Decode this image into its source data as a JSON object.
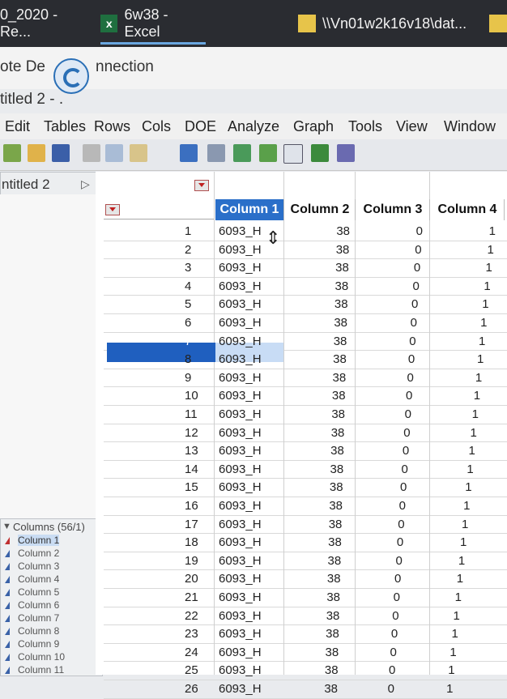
{
  "taskbar": {
    "items": [
      {
        "label": "0_2020 - Re...",
        "icon": "app-icon"
      },
      {
        "label": "6w38 - Excel",
        "icon": "excel-icon"
      },
      {
        "label": "\\\\Vn01w2k16v18\\dat...",
        "icon": "folder-icon"
      }
    ]
  },
  "remote": {
    "left_text": "ote De",
    "right_text": "nnection",
    "icon": "remote-desktop-icon"
  },
  "window_title": "titled 2 - .",
  "menu": [
    "Edit",
    "Tables",
    "Rows",
    "Cols",
    "DOE",
    "Analyze",
    "Graph",
    "Tools",
    "View",
    "Window"
  ],
  "table_panel": {
    "title": "ntitled 2"
  },
  "columns_panel": {
    "header": "Columns (56/1)",
    "items": [
      "Column 1",
      "Column 2",
      "Column 3",
      "Column 4",
      "Column 5",
      "Column 6",
      "Column 7",
      "Column 8",
      "Column 9",
      "Column 10",
      "Column 11"
    ]
  },
  "grid": {
    "headers": [
      "Column 1",
      "Column 2",
      "Column 3",
      "Column 4"
    ],
    "selected_row": 7,
    "rows": [
      {
        "n": "1",
        "c1": "6093_H",
        "c2": "38",
        "c3": "0",
        "c4": "1"
      },
      {
        "n": "2",
        "c1": "6093_H",
        "c2": "38",
        "c3": "0",
        "c4": "1"
      },
      {
        "n": "3",
        "c1": "6093_H",
        "c2": "38",
        "c3": "0",
        "c4": "1"
      },
      {
        "n": "4",
        "c1": "6093_H",
        "c2": "38",
        "c3": "0",
        "c4": "1"
      },
      {
        "n": "5",
        "c1": "6093_H",
        "c2": "38",
        "c3": "0",
        "c4": "1"
      },
      {
        "n": "6",
        "c1": "6093_H",
        "c2": "38",
        "c3": "0",
        "c4": "1"
      },
      {
        "n": "7",
        "c1": "6093_H",
        "c2": "38",
        "c3": "0",
        "c4": "1"
      },
      {
        "n": "8",
        "c1": "6093_H",
        "c2": "38",
        "c3": "0",
        "c4": "1"
      },
      {
        "n": "9",
        "c1": "6093_H",
        "c2": "38",
        "c3": "0",
        "c4": "1"
      },
      {
        "n": "10",
        "c1": "6093_H",
        "c2": "38",
        "c3": "0",
        "c4": "1"
      },
      {
        "n": "11",
        "c1": "6093_H",
        "c2": "38",
        "c3": "0",
        "c4": "1"
      },
      {
        "n": "12",
        "c1": "6093_H",
        "c2": "38",
        "c3": "0",
        "c4": "1"
      },
      {
        "n": "13",
        "c1": "6093_H",
        "c2": "38",
        "c3": "0",
        "c4": "1"
      },
      {
        "n": "14",
        "c1": "6093_H",
        "c2": "38",
        "c3": "0",
        "c4": "1"
      },
      {
        "n": "15",
        "c1": "6093_H",
        "c2": "38",
        "c3": "0",
        "c4": "1"
      },
      {
        "n": "16",
        "c1": "6093_H",
        "c2": "38",
        "c3": "0",
        "c4": "1"
      },
      {
        "n": "17",
        "c1": "6093_H",
        "c2": "38",
        "c3": "0",
        "c4": "1"
      },
      {
        "n": "18",
        "c1": "6093_H",
        "c2": "38",
        "c3": "0",
        "c4": "1"
      },
      {
        "n": "19",
        "c1": "6093_H",
        "c2": "38",
        "c3": "0",
        "c4": "1"
      },
      {
        "n": "20",
        "c1": "6093_H",
        "c2": "38",
        "c3": "0",
        "c4": "1"
      },
      {
        "n": "21",
        "c1": "6093_H",
        "c2": "38",
        "c3": "0",
        "c4": "1"
      },
      {
        "n": "22",
        "c1": "6093_H",
        "c2": "38",
        "c3": "0",
        "c4": "1"
      },
      {
        "n": "23",
        "c1": "6093_H",
        "c2": "38",
        "c3": "0",
        "c4": "1"
      },
      {
        "n": "24",
        "c1": "6093_H",
        "c2": "38",
        "c3": "0",
        "c4": "1"
      },
      {
        "n": "25",
        "c1": "6093_H",
        "c2": "38",
        "c3": "0",
        "c4": "1"
      },
      {
        "n": "26",
        "c1": "6093_H",
        "c2": "38",
        "c3": "0",
        "c4": "1"
      }
    ]
  },
  "colors": {
    "selection": "#1f5fbf",
    "header_selected": "#2a6fc9"
  }
}
